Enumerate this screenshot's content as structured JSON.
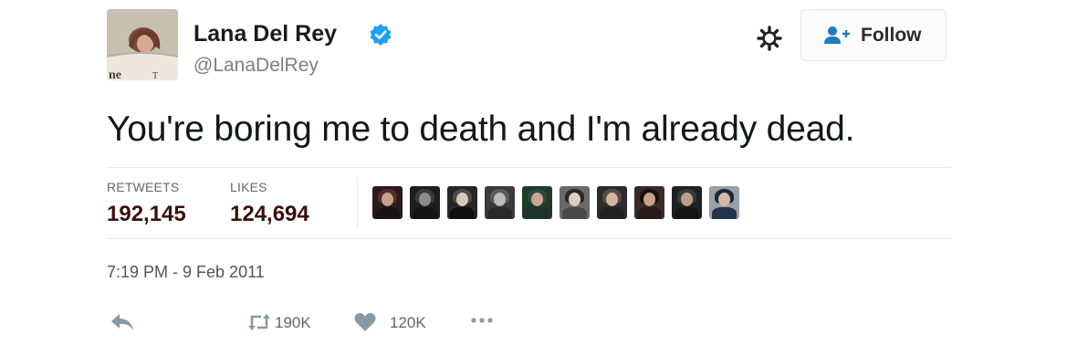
{
  "user": {
    "display_name": "Lana Del Rey",
    "username": "@LanaDelRey",
    "verified_icon": "verified-badge-icon",
    "avatar_icon": "profile-photo"
  },
  "header": {
    "gear_icon": "gear-icon",
    "follow_label": "Follow",
    "follow_icon": "add-person-icon"
  },
  "tweet": {
    "text": "You're boring me to death and I'm already dead."
  },
  "stats": {
    "retweets_label": "RETWEETS",
    "retweets_value": "192,145",
    "likes_label": "LIKES",
    "likes_value": "124,694",
    "liker_avatar_count": 10
  },
  "meta": {
    "timestamp": "7:19 PM - 9 Feb 2011"
  },
  "actions": {
    "reply_icon": "reply-arrow-icon",
    "retweet_icon": "retweet-icon",
    "retweet_count": "190K",
    "like_icon": "heart-icon",
    "like_count": "120K",
    "more_icon": "more-dots-icon"
  },
  "colors": {
    "verified": "#1da1f2",
    "stat_value": "#3a0f0f",
    "muted": "#77818a",
    "action_icon": "#8899a6"
  }
}
